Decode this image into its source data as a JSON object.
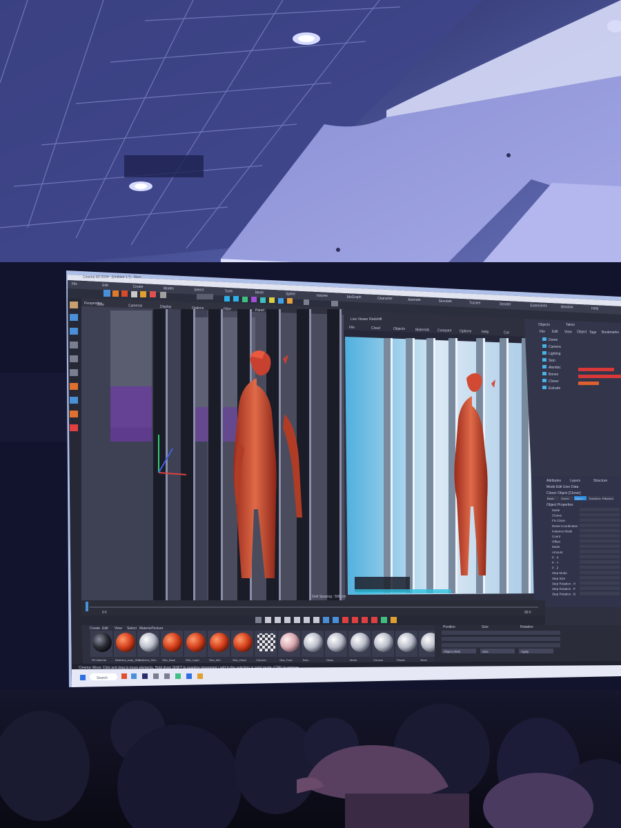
{
  "app": {
    "window_title": "Cinema 4D 2024 - [Untitled 1 *] - Main",
    "menus": [
      "File",
      "Edit",
      "Create",
      "Modes",
      "Select",
      "Tools",
      "Mesh",
      "Spline",
      "Volume",
      "MoGraph",
      "Character",
      "Animate",
      "Simulate",
      "Tracker",
      "Render",
      "Extensions",
      "Window",
      "Help"
    ],
    "viewport_menus": [
      "View",
      "Cameras",
      "Display",
      "Options",
      "Filter",
      "Panel"
    ],
    "viewport_label": "Perspective",
    "grid_spacing": "Grid Spacing : 500 cm",
    "frame_start": "0 F",
    "frame_end": "90 F"
  },
  "render_view": {
    "title": "Live Viewer Redshift",
    "menus": [
      "File",
      "Cloud",
      "Objects",
      "Materials",
      "Compare",
      "Options",
      "Help",
      "Cut"
    ]
  },
  "objects_panel": {
    "tabs": [
      "Objects",
      "Takes"
    ],
    "menus": [
      "File",
      "Edit",
      "View",
      "Object",
      "Tags",
      "Bookmarks"
    ],
    "items": [
      "Dome",
      "Camera",
      "Lighting",
      "Skin",
      "Alembic",
      "Bones",
      "Cloner",
      "Extrude"
    ]
  },
  "attributes_panel": {
    "tabs": [
      "Attributes",
      "Layers",
      "Structure"
    ],
    "mode_menus": [
      "Mode",
      "Edit",
      "User Data"
    ],
    "title": "Cloner Object [Cloner]",
    "sub_tabs": [
      "Basic",
      "Coord.",
      "Object",
      "Transform",
      "Effectors"
    ],
    "section": "Object Properties",
    "fields": [
      "Mode",
      "Clones",
      "Fix Clone",
      "Reset Coordinates",
      "Instance Mode",
      "Count",
      "Offset",
      "Mode",
      "Amount",
      "P . X",
      "P . Y",
      "P . Z",
      "Step Mode",
      "Step Size",
      "Step Rotation . H",
      "Step Rotation . P",
      "Step Rotation . B"
    ]
  },
  "material_manager": {
    "menus": [
      "Create",
      "Edit",
      "View",
      "Select",
      "Material",
      "Texture"
    ],
    "materials": [
      "RS Material",
      "Ballerina_wrap_Skin",
      "Ballerina_Skin",
      "Skin_Base",
      "Skin_Layer",
      "Skin_Mid",
      "Skin_Head",
      "Checker",
      "Skin_Face",
      "Bars",
      "Glass",
      "Metal",
      "Chrome",
      "Plastic",
      "Silver"
    ]
  },
  "coordinates": {
    "headers": [
      "Position",
      "Size",
      "Rotation"
    ],
    "buttons": [
      "Object (Rel)",
      "Size",
      "Apply"
    ]
  },
  "status_bar": {
    "text": "Cinema: Move: Click and drag to move elements. Hold down SHIFT to quantize movement / add to the selection in point mode, CTRL to remove."
  },
  "taskbar": {
    "search_placeholder": "Search"
  },
  "colors": {
    "accent": "#2f8fe0",
    "character_skin": "#d8583a",
    "ui_background": "#3a3d4e",
    "screen_glow": "#aebfe8"
  }
}
